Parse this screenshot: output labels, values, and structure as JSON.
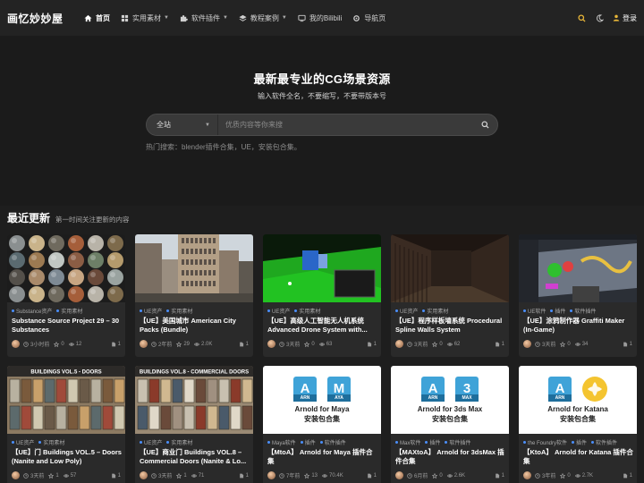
{
  "header": {
    "logo": "画忆妙妙屋",
    "nav": [
      {
        "label": "首页",
        "icon": "home-icon",
        "active": true,
        "dropdown": false
      },
      {
        "label": "实用素材",
        "icon": "grid-icon",
        "active": false,
        "dropdown": true
      },
      {
        "label": "软件插件",
        "icon": "puzzle-icon",
        "active": false,
        "dropdown": true
      },
      {
        "label": "教程案例",
        "icon": "layers-icon",
        "active": false,
        "dropdown": true
      },
      {
        "label": "我的Bilibili",
        "icon": "monitor-icon",
        "active": false,
        "dropdown": false
      },
      {
        "label": "导航页",
        "icon": "gear-icon",
        "active": false,
        "dropdown": false
      }
    ],
    "login": "登录"
  },
  "hero": {
    "title": "最新最专业的CG场景资源",
    "subtitle": "输入软件全名，不要缩写，不要带版本号",
    "search": {
      "scope": "全站",
      "placeholder": "优质内容等你来搜"
    },
    "hot": "热门搜索：blender插件合集，UE，安装包合集。"
  },
  "section": {
    "title": "最近更新",
    "subtitle": "第一时间关注更新的内容"
  },
  "cards": [
    {
      "tags": [
        "Substance资产",
        "实用素材"
      ],
      "title": "Substance Source Project 29 – 30 Substances",
      "time": "3小时前",
      "stars": "0",
      "views": "12",
      "count": "1",
      "thumb": "materials"
    },
    {
      "tags": [
        "UE资产",
        "实用素材"
      ],
      "title": "【UE】美国城市 American City Packs (Bundle)",
      "time": "2年前",
      "stars": "29",
      "views": "2.0K",
      "count": "1",
      "thumb": "city"
    },
    {
      "tags": [
        "UE资产",
        "实用素材"
      ],
      "title": "【UE】高级人工智能无人机系统 Advanced Drone System with...",
      "time": "3天前",
      "stars": "0",
      "views": "63",
      "count": "1",
      "thumb": "drone"
    },
    {
      "tags": [
        "UE资产",
        "实用素材"
      ],
      "title": "【UE】程序样板墙系统 Procedural Spline Walls System",
      "time": "3天前",
      "stars": "0",
      "views": "62",
      "count": "1",
      "thumb": "walls"
    },
    {
      "tags": [
        "UE软件",
        "插件",
        "软件插件"
      ],
      "title": "【UE】涂鸦制作器 Graffiti Maker (In-Game)",
      "time": "3天前",
      "stars": "0",
      "views": "34",
      "count": "1",
      "thumb": "graffiti"
    },
    {
      "tags": [
        "UE资产",
        "实用素材"
      ],
      "title": "【UE】门 Buildings VOL.5 – Doors (Nanite and Low Poly)",
      "time": "3天前",
      "stars": "1",
      "views": "57",
      "count": "1",
      "thumb": "doors1",
      "banner": "BUILDINGS VOL.5 - DOORS"
    },
    {
      "tags": [
        "UE资产",
        "实用素材"
      ],
      "title": "【UE】商业门 Buildings VOL.8 – Commercial Doors (Nanite & Lo...",
      "time": "3天前",
      "stars": "1",
      "views": "71",
      "count": "1",
      "thumb": "doors2",
      "banner": "BUILDINGS VOL.8 - COMMERCIAL DOORS"
    },
    {
      "tags": [
        "Maya软件",
        "插件",
        "软件插件"
      ],
      "title": "【MtoA】 Arnold for Maya 插件合集",
      "time": "7年前",
      "stars": "13",
      "views": "70.4K",
      "count": "1",
      "thumb": "sw",
      "sw": {
        "icons": [
          {
            "big": "A",
            "small": "ARN"
          },
          {
            "big": "M",
            "small": "AYA"
          }
        ],
        "line1": "Arnold for Maya",
        "line2": "安装包合集"
      }
    },
    {
      "tags": [
        "Max软件",
        "插件",
        "软件插件"
      ],
      "title": "【MAXtoA】 Arnold for 3dsMax 插件合集",
      "time": "6月前",
      "stars": "0",
      "views": "2.6K",
      "count": "1",
      "thumb": "sw",
      "sw": {
        "icons": [
          {
            "big": "A",
            "small": "ARN"
          },
          {
            "big": "3",
            "small": "MAX"
          }
        ],
        "line1": "Arnold for 3ds Max",
        "line2": "安装包合集"
      }
    },
    {
      "tags": [
        "the Foundry软件",
        "插件",
        "软件插件"
      ],
      "title": "【KtoA】 Arnold for Katana 插件合集",
      "time": "3年前",
      "stars": "0",
      "views": "2.7K",
      "count": "1",
      "thumb": "sw",
      "sw": {
        "icons": [
          {
            "big": "A",
            "small": "ARN"
          },
          {
            "big": "",
            "small": ""
          }
        ],
        "line1": "Arnold for Katana",
        "line2": "安装包合集"
      }
    }
  ],
  "colors": {
    "accent": "#e8b638",
    "tagDot": "#4b90ff",
    "maya": "#3fa3d8"
  }
}
